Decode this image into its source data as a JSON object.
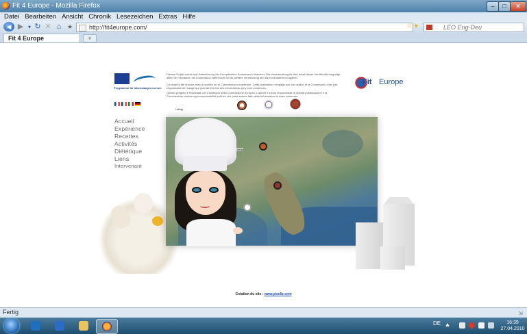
{
  "window": {
    "title": "Fit 4 Europe - Mozilla Firefox",
    "minimize_icon": "minimize-icon",
    "maximize_icon": "maximize-icon",
    "close_icon": "close-icon"
  },
  "menu": [
    "Datei",
    "Bearbeiten",
    "Ansicht",
    "Chronik",
    "Lesezeichen",
    "Extras",
    "Hilfe"
  ],
  "navbar": {
    "url": "http://fit4europe.com/",
    "search_placeholder": "LEO Eng-Deu"
  },
  "tabs": [
    {
      "label": "Fit 4 Europe"
    }
  ],
  "page": {
    "eu_program_label": "Programme für lebenslanges Lernen",
    "disclaimer_de": "Dieses Projekt wurde mit Unterstützung der Europäischen Kommission finanziert. Die Verantwortung für den Inhalt dieser Veröffentlichung trägt allein der Verfasser; die Kommission haftet nicht für die weitere Verwendung der darin enthaltenen Angaben.",
    "disclaimer_fr": "Ce projet a été financé avec le soutien de la Commission européenne. Cette publication n'engage que son auteur et la Commission n'est pas responsable de l'usage qui pourrait être fait des informations qui y sont contenues.",
    "disclaimer_it": "Questo progetto è finanziato con il sostegno della Commissione europea. L'autore è il solo responsabile di questa pubblicazione e la Commissione declina ogni responsabilità sull'uso che potrà essere fatto delle informazioni in essa contenute.",
    "partner_label": "Liebig",
    "fit_logo_part1": "Fit",
    "fit_logo_part2": "Europe",
    "fit_logo_number": "4",
    "nav": [
      "Accueil",
      "Expérience",
      "Recettes",
      "Activités",
      "Diététique",
      "Liens",
      "Intervenant"
    ],
    "map_marker_label": "Liebig",
    "credit_prefix": "Création du site : ",
    "credit_link": "www.pixeliz.com"
  },
  "status": "Fertig",
  "taskbar": {
    "tray_lang": "DE",
    "time": "16:39",
    "date": "27.04.2010"
  },
  "colors": {
    "flag_de": [
      "#000000",
      "#dd0000",
      "#ffce00"
    ],
    "flag_fr": [
      "#0055a4",
      "#ffffff",
      "#ef4135"
    ],
    "flag_it": [
      "#009246",
      "#ffffff",
      "#ce2b37"
    ]
  }
}
